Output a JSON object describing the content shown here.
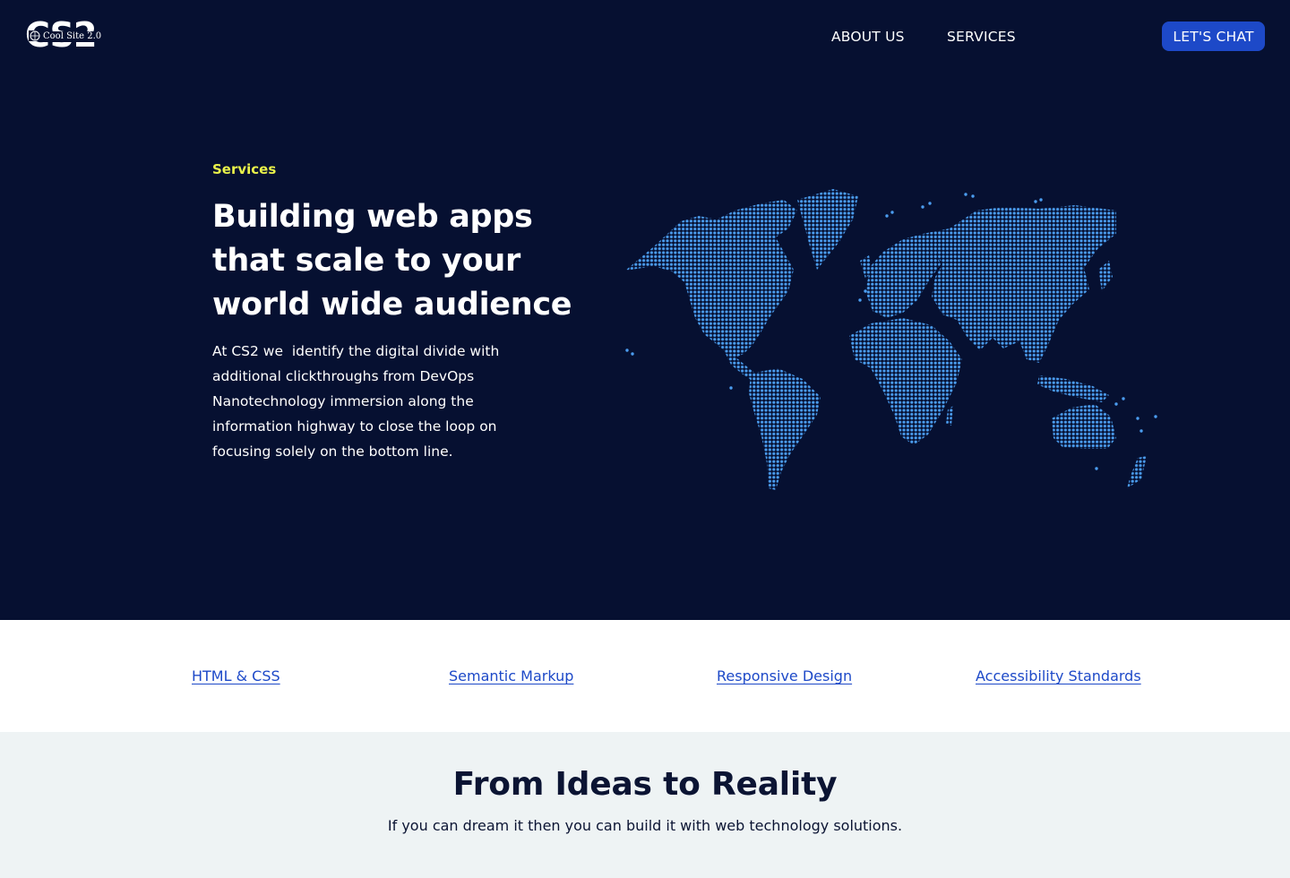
{
  "header": {
    "logo_text": "CS2",
    "logo_subtext": "Cool Site 2.0",
    "nav": {
      "about": "ABOUT US",
      "services": "SERVICES",
      "cta": "LET'S CHAT"
    }
  },
  "hero": {
    "eyebrow": "Services",
    "headline": "Building web apps that scale to your world wide audience",
    "body": "At CS2 we  identify the digital divide with additional clickthroughs from DevOps Nanotechnology immersion along the information highway to close the loop on focusing solely on the bottom line."
  },
  "topics": [
    {
      "label": "HTML & CSS"
    },
    {
      "label": "Semantic Markup"
    },
    {
      "label": "Responsive Design"
    },
    {
      "label": "Accessibility Standards"
    }
  ],
  "section": {
    "title": "From Ideas to Reality",
    "subtitle": "If you can dream it then you can build it with web technology solutions."
  },
  "colors": {
    "hero_bg": "#061031",
    "accent_yellow": "#e9f24a",
    "brand_blue": "#1d49c8",
    "map_dot": "#4b9df0"
  },
  "icons": {
    "logo_globe": "globe-icon",
    "map": "world-map-dots"
  }
}
